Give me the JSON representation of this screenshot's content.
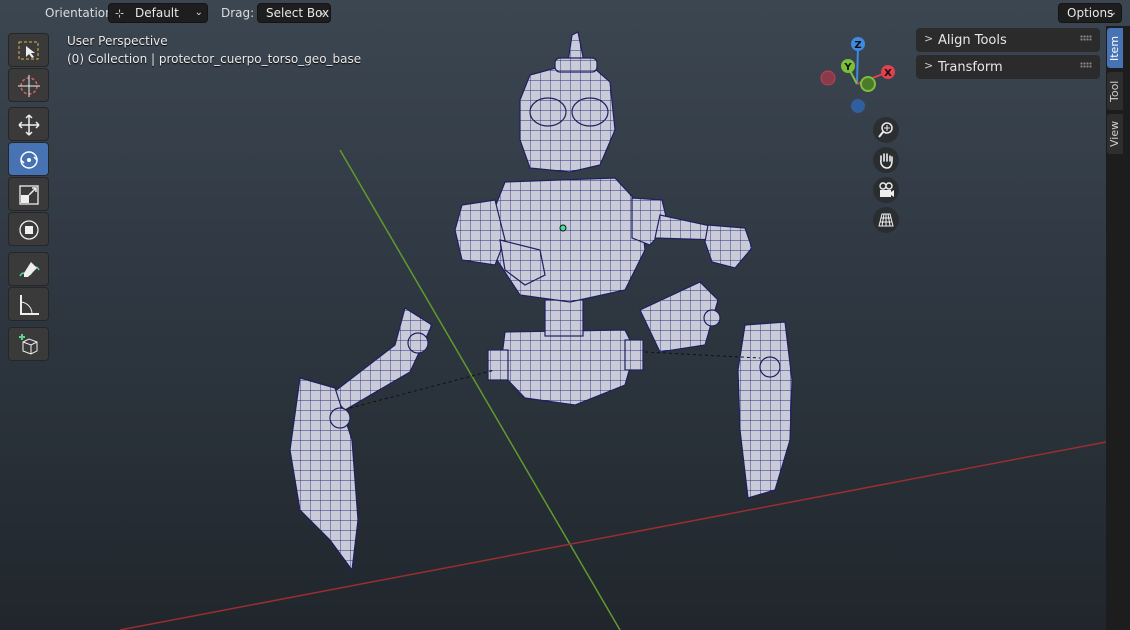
{
  "header": {
    "orientation_label": "Orientation:",
    "orientation_value": "Default",
    "drag_label": "Drag:",
    "drag_value": "Select Box",
    "options_label": "Options"
  },
  "viewport": {
    "perspective_label": "User Perspective",
    "collection_label": "(0) Collection | protector_cuerpo_torso_geo_base"
  },
  "gizmo": {
    "z": "Z",
    "y": "Y",
    "x": "X"
  },
  "toolbar": {
    "tools": [
      {
        "name": "select-box",
        "active": false
      },
      {
        "name": "cursor",
        "active": false
      },
      {
        "name": "move",
        "active": false
      },
      {
        "name": "rotate",
        "active": true
      },
      {
        "name": "scale",
        "active": false
      },
      {
        "name": "transform",
        "active": false
      },
      {
        "name": "annotate",
        "active": false
      },
      {
        "name": "measure",
        "active": false
      },
      {
        "name": "add-cube",
        "active": false
      }
    ]
  },
  "nav_buttons": [
    "zoom-icon",
    "hand-pan-icon",
    "camera-icon",
    "grid-icon"
  ],
  "panels": [
    {
      "title": "Align Tools"
    },
    {
      "title": "Transform"
    }
  ],
  "side_tabs": [
    {
      "label": "Item",
      "active": true
    },
    {
      "label": "Tool",
      "active": false
    },
    {
      "label": "View",
      "active": false
    }
  ],
  "colors": {
    "accent": "#4772b3",
    "axis_x": "#e0414f",
    "axis_y": "#7cbf3a",
    "axis_z": "#3f8ae0"
  }
}
